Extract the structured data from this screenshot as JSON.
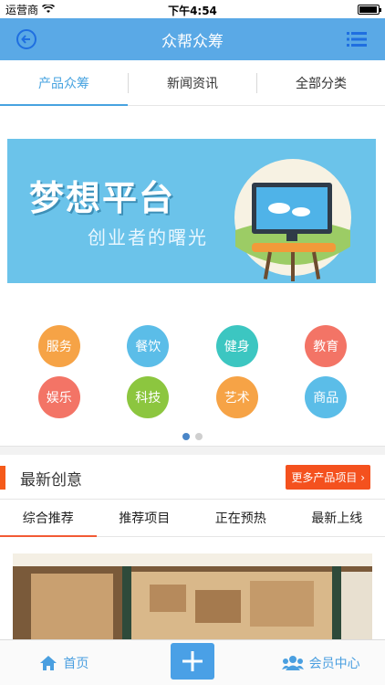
{
  "status": {
    "carrier": "运营商",
    "time": "下午4:54"
  },
  "nav": {
    "title": "众帮众筹"
  },
  "tabs": [
    {
      "label": "产品众筹",
      "active": true
    },
    {
      "label": "新闻资讯",
      "active": false
    },
    {
      "label": "全部分类",
      "active": false
    }
  ],
  "banner": {
    "title": "梦想平台",
    "subtitle": "创业者的曙光"
  },
  "categories_row1": [
    {
      "label": "服务",
      "color": "#f6a346"
    },
    {
      "label": "餐饮",
      "color": "#5bbde8"
    },
    {
      "label": "健身",
      "color": "#3cc6c1"
    },
    {
      "label": "教育",
      "color": "#f37466"
    }
  ],
  "categories_row2": [
    {
      "label": "娱乐",
      "color": "#f37466"
    },
    {
      "label": "科技",
      "color": "#8cc63f"
    },
    {
      "label": "艺术",
      "color": "#f6a346"
    },
    {
      "label": "商品",
      "color": "#5bbde8"
    }
  ],
  "section": {
    "title": "最新创意",
    "more_label": "更多产品项目 ›"
  },
  "sub_tabs": [
    {
      "label": "综合推荐",
      "active": true
    },
    {
      "label": "推荐项目",
      "active": false
    },
    {
      "label": "正在预热",
      "active": false
    },
    {
      "label": "最新上线",
      "active": false
    }
  ],
  "tab_bar": {
    "home": "首页",
    "member": "会员中心"
  },
  "colors": {
    "primary": "#5aa9e6",
    "accent": "#f4511e"
  }
}
